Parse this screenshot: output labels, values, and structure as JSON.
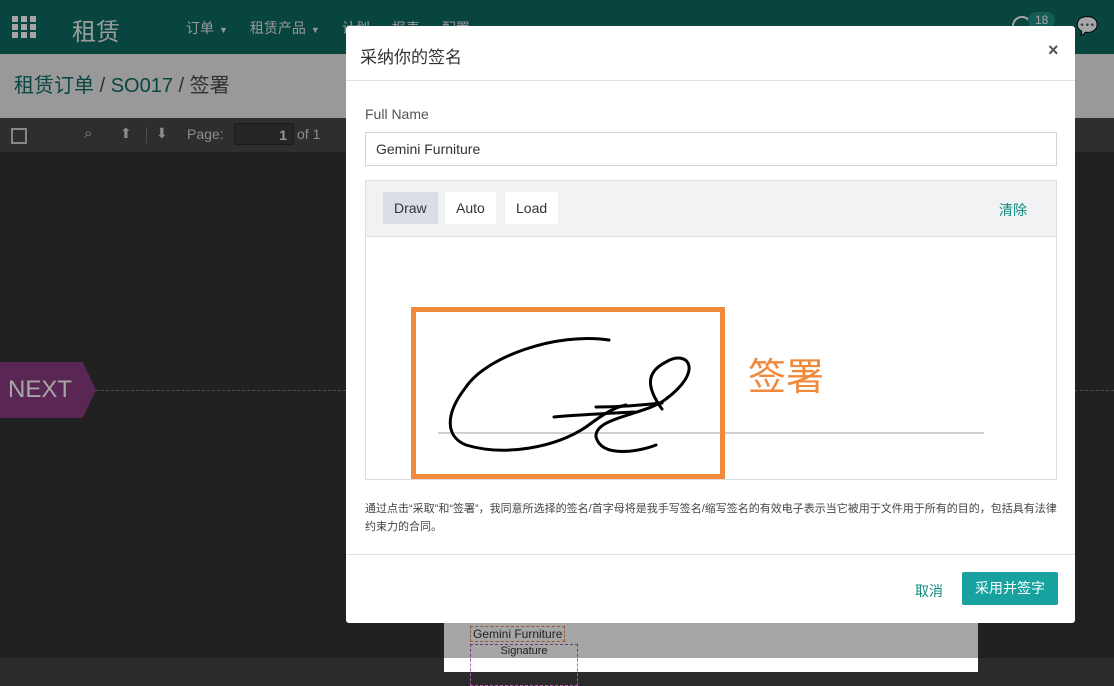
{
  "navbar": {
    "app_title": "租赁",
    "menu": [
      "订单",
      "租赁产品",
      "计划",
      "报表",
      "配置"
    ],
    "activity_count": "18"
  },
  "breadcrumb": {
    "parent": "租赁订单",
    "order": "SO017",
    "current": "签署"
  },
  "pdf_toolbar": {
    "page_label": "Page:",
    "page_value": "1",
    "page_total": "of 1"
  },
  "document": {
    "next_tag": "NEXT",
    "name_field": "Gemini Furniture",
    "signature_field": "Signature"
  },
  "modal": {
    "title": "采纳你的签名",
    "close": "×",
    "full_name_label": "Full Name",
    "full_name_value": "Gemini Furniture",
    "modes": [
      "Draw",
      "Auto",
      "Load"
    ],
    "active_mode": "Draw",
    "clear": "清除",
    "notice": "通过点击“采取”和“签署”，我同意所选择的签名/首字母将是我手写签名/缩写签名的有效电子表示当它被用于文件用于所有的目的，包括具有法律约束力的合同。",
    "cancel": "取消",
    "adopt": "采用并签字"
  },
  "annotation": {
    "label": "签署",
    "color": "#f0893b"
  },
  "colors": {
    "navbar": "#0e6b61",
    "primary_button": "#17a2a0",
    "link": "#0e8a7e",
    "next_tag": "#8a3d82"
  }
}
